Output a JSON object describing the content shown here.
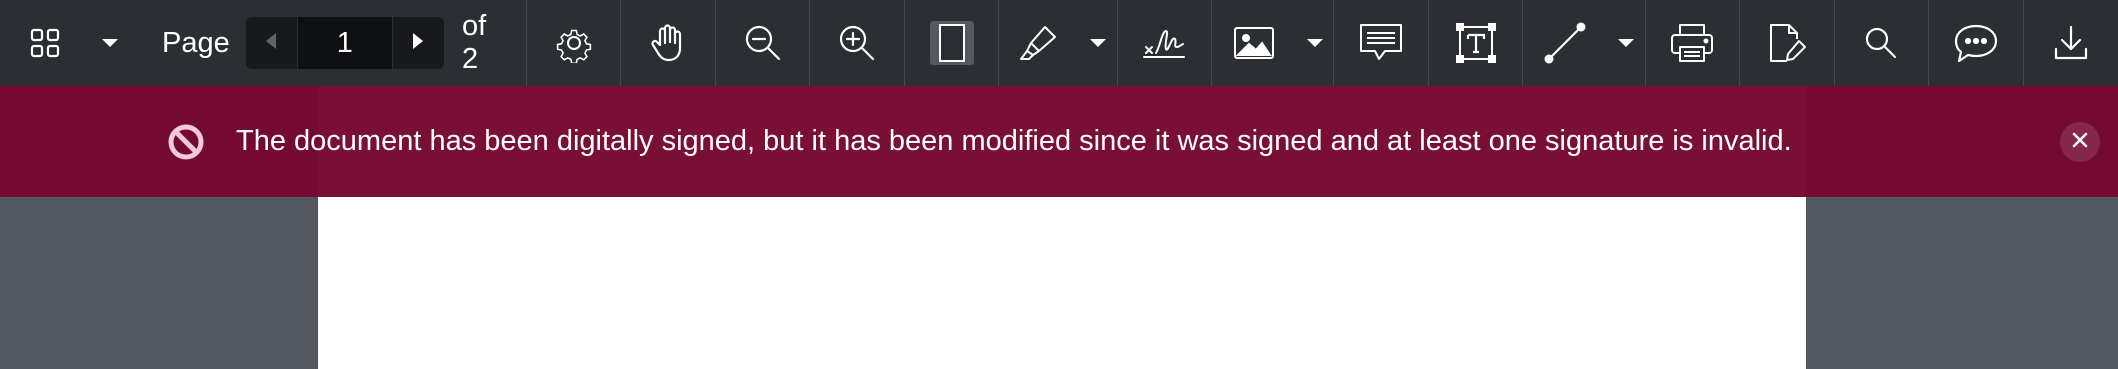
{
  "toolbar": {
    "page_label": "Page",
    "current_page": "1",
    "of_label": "of 2"
  },
  "icons": {
    "thumbnails": "grid-icon",
    "dropdown": "caret-down-icon",
    "prev": "triangle-left-icon",
    "next": "triangle-right-icon",
    "settings": "gear-icon",
    "pan": "hand-icon",
    "zoom_out": "zoom-out-icon",
    "zoom_in": "zoom-in-icon",
    "fit": "page-fit-icon",
    "highlight": "highlighter-icon",
    "signature": "signature-icon",
    "image": "image-icon",
    "comment": "comment-box-icon",
    "text": "text-box-icon",
    "line": "line-icon",
    "print": "printer-icon",
    "edit": "edit-document-icon",
    "search": "search-icon",
    "chat": "chat-bubble-icon",
    "download": "download-icon",
    "blocked": "no-entry-icon",
    "close": "close-icon"
  },
  "banner": {
    "message": "The document has been digitally signed, but it has been modified since it was signed and at least one signature is invalid."
  },
  "colors": {
    "toolbar_bg": "#2b2e33",
    "banner_bg": "#760730",
    "viewer_bg": "#525760",
    "page_bg": "#ffffff"
  }
}
